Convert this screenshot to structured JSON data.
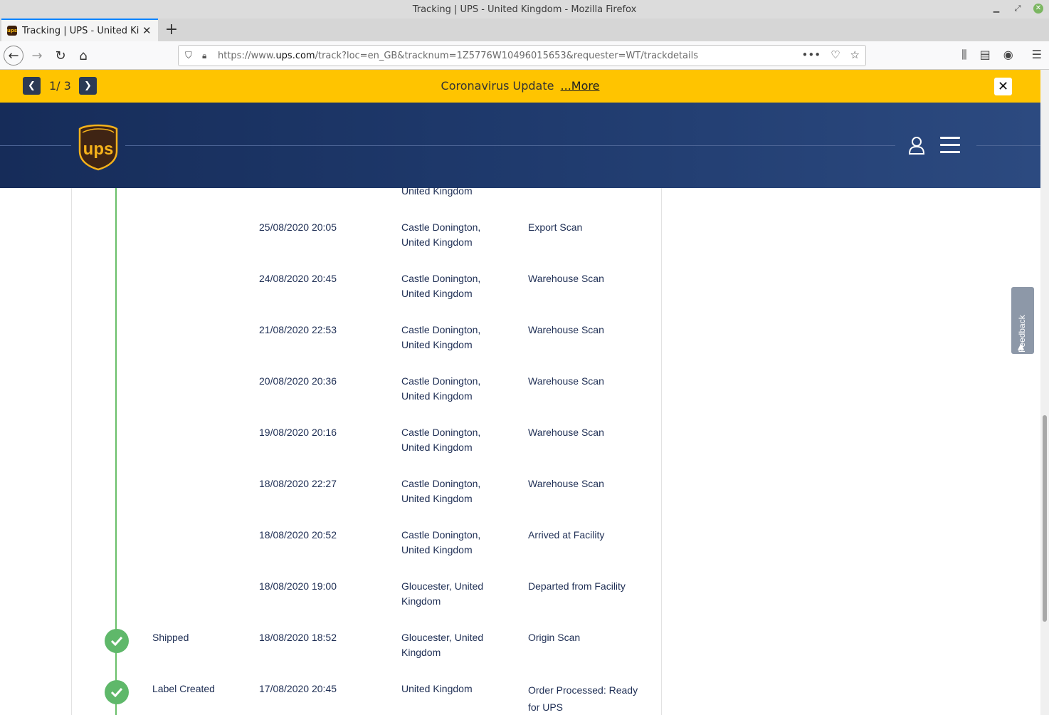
{
  "window": {
    "title": "Tracking | UPS - United Kingdom - Mozilla Firefox"
  },
  "tab": {
    "label": "Tracking | UPS - United Kingdom",
    "favicon_text": "ups"
  },
  "urlbar": {
    "prefix": "https://www.",
    "domain": "ups.com",
    "path": "/track?loc=en_GB&tracknum=1Z5776W10496015653&requester=WT/trackdetails"
  },
  "banner": {
    "count": "1/ 3",
    "text": "Coronavirus Update",
    "more": "...More"
  },
  "header": {
    "logo_text": "ups"
  },
  "feedback": {
    "label": "Feedback"
  },
  "rows": [
    {
      "status": "",
      "date": "",
      "location": "United Kingdom",
      "activity": ""
    },
    {
      "status": "",
      "date": "25/08/2020  20:05",
      "location": "Castle Donington, United Kingdom",
      "activity": "Export Scan"
    },
    {
      "status": "",
      "date": "24/08/2020  20:45",
      "location": "Castle Donington, United Kingdom",
      "activity": "Warehouse Scan"
    },
    {
      "status": "",
      "date": "21/08/2020  22:53",
      "location": "Castle Donington, United Kingdom",
      "activity": "Warehouse Scan"
    },
    {
      "status": "",
      "date": "20/08/2020  20:36",
      "location": "Castle Donington, United Kingdom",
      "activity": "Warehouse Scan"
    },
    {
      "status": "",
      "date": "19/08/2020  20:16",
      "location": "Castle Donington, United Kingdom",
      "activity": "Warehouse Scan"
    },
    {
      "status": "",
      "date": "18/08/2020  22:27",
      "location": "Castle Donington, United Kingdom",
      "activity": "Warehouse Scan"
    },
    {
      "status": "",
      "date": "18/08/2020  20:52",
      "location": "Castle Donington, United Kingdom",
      "activity": "Arrived at Facility"
    },
    {
      "status": "",
      "date": "18/08/2020  19:00",
      "location": "Gloucester, United Kingdom",
      "activity": "Departed from Facility"
    },
    {
      "status": "Shipped",
      "date": "18/08/2020  18:52",
      "location": "Gloucester, United Kingdom",
      "activity": "Origin Scan"
    },
    {
      "status": "Label Created",
      "date": "17/08/2020  20:45",
      "location": "United Kingdom",
      "activity": "Order Processed: Ready for UPS"
    }
  ]
}
